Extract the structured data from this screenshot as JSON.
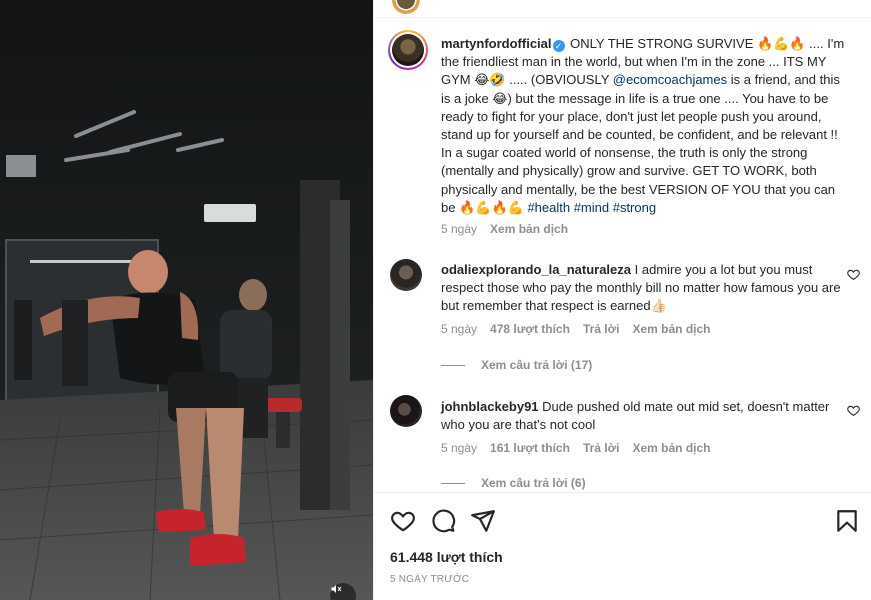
{
  "post": {
    "caption": {
      "username": "martynfordofficial",
      "verified_badge": "✓",
      "text_1": " ONLY THE STRONG SURVIVE 🔥💪🔥 .... I'm the friendliest man in the world, but when I'm in the zone ... ITS MY GYM 😂🤣 ..... (OBVIOUSLY ",
      "mention": "@ecomcoachjames",
      "text_2": " is a friend, and this is a joke 😂) but the message in life is a true one .... You have to be ready to fight for your place, don't just let people push you around, stand up for yourself and be counted, be confident, and be relevant !! In a sugar coated world of nonsense, the truth is only the strong (mentally and physically) grow and survive. GET TO WORK, both physically and mentally, be the best VERSION OF YOU that you can be 🔥💪🔥💪 ",
      "hashtags": "#health #mind #strong",
      "time": "5 ngày",
      "translate": "Xem bản dịch"
    },
    "comments": [
      {
        "username": "odaliexplorando_la_naturaleza",
        "text": " I admire you a lot but you must respect those who pay the monthly bill no matter how famous you are but remember that respect is earned👍🏻",
        "time": "5 ngày",
        "likes": "478 lượt thích",
        "reply": "Trả lời",
        "translate": "Xem bản dịch",
        "view_replies": "Xem câu trả lời (17)"
      },
      {
        "username": "johnblackeby91",
        "text": " Dude pushed old mate out mid set, doesn't matter who you are that's not cool",
        "time": "5 ngày",
        "likes": "161 lượt thích",
        "reply": "Trả lời",
        "translate": "Xem bản dịch",
        "view_replies": "Xem câu trả lời (6)"
      }
    ],
    "like_count": "61.448 lượt thích",
    "date": "5 NGÀY TRƯỚC"
  },
  "icons": {
    "like": "heart-icon",
    "comment": "comment-icon",
    "share": "share-icon",
    "save": "bookmark-icon",
    "mute": "muted-speaker-icon"
  },
  "colors": {
    "link": "#00376b",
    "muted_text": "#8e8e8e",
    "verified": "#3897f0",
    "text": "#262626"
  }
}
